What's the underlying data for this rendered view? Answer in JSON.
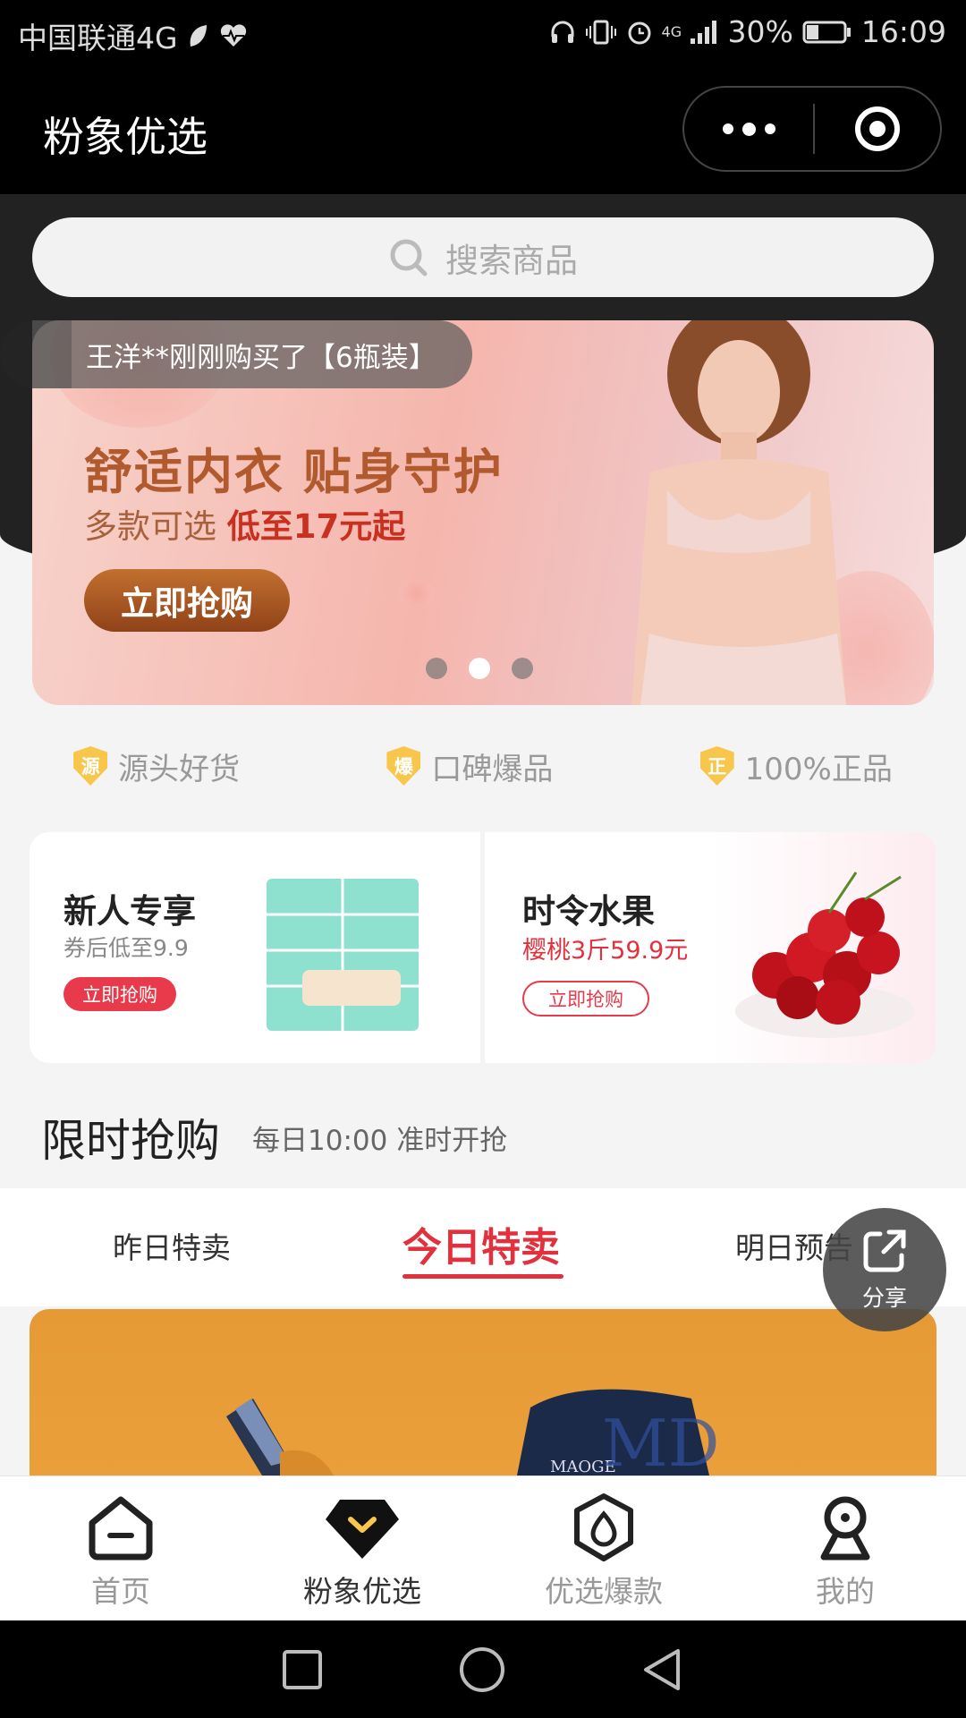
{
  "status_bar": {
    "carrier": "中国联通4G",
    "network": "4G",
    "battery": "30%",
    "time": "16:09"
  },
  "app": {
    "title": "粉象优选"
  },
  "search": {
    "placeholder": "搜索商品"
  },
  "banner": {
    "toast": "王洋**刚刚购买了【6瓶装】",
    "headline": "舒适内衣 贴身守护",
    "subline_prefix": "多款可选",
    "subline_price": "低至17元起",
    "button": "立即抢购",
    "dots": 3,
    "active_dot": 1
  },
  "features": [
    {
      "badge": "源",
      "label": "源头好货"
    },
    {
      "badge": "爆",
      "label": "口碑爆品"
    },
    {
      "badge": "正",
      "label": "100%正品"
    }
  ],
  "promos": {
    "left": {
      "title": "新人专享",
      "subtitle": "券后低至9.9",
      "button": "立即抢购"
    },
    "right": {
      "title": "时令水果",
      "subtitle": "樱桃3斤59.9元",
      "button": "立即抢购"
    }
  },
  "flash_sale": {
    "title": "限时抢购",
    "subtitle": "每日10:00 准时开抢"
  },
  "tabs": {
    "yesterday": "昨日特卖",
    "today": "今日特卖",
    "tomorrow": "明日预告"
  },
  "product_card": {
    "brand_text": "MAOGE"
  },
  "share": {
    "label": "分享"
  },
  "tabbar": [
    {
      "label": "首页",
      "icon": "home-icon"
    },
    {
      "label": "粉象优选",
      "icon": "diamond-icon"
    },
    {
      "label": "优选爆款",
      "icon": "drop-icon"
    },
    {
      "label": "我的",
      "icon": "person-icon"
    }
  ],
  "colors": {
    "accent": "#e2313d",
    "banner_text": "#b15a2e",
    "badge": "#f7c64a"
  }
}
